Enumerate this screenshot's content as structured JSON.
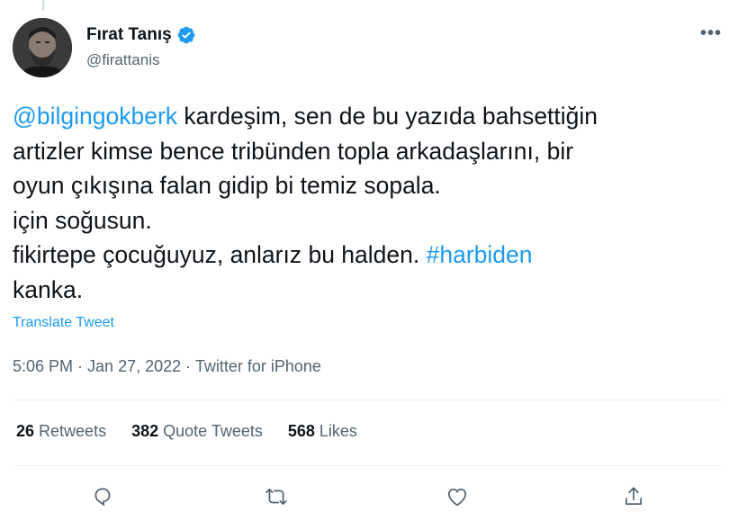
{
  "author": {
    "display_name": "Fırat Tanış",
    "handle": "@firattanis",
    "verified_icon": "verified-badge-icon",
    "avatar": "profile-photo"
  },
  "more_icon": "more-horizontal-icon",
  "tweet": {
    "line1_mention": "@bilgingokberk",
    "line1_rest": " kardeşim, sen de bu yazıda bahsettiğin",
    "line2": "artizler kimse bence tribünden topla arkadaşlarını, bir",
    "line3": "oyun çıkışına falan gidip bi temiz sopala.",
    "line4": "için soğusun.",
    "line5_text": "fikirtepe çocuğuyuz, anlarız bu halden. ",
    "line5_hashtag": "#harbiden",
    "line6": "kanka."
  },
  "translate_label": "Translate Tweet",
  "meta": {
    "time": "5:06 PM",
    "separator1": " · ",
    "date": "Jan 27, 2022",
    "separator2": " · ",
    "source": "Twitter for iPhone"
  },
  "stats": {
    "retweets_count": "26",
    "retweets_label": "Retweets",
    "quotes_count": "382",
    "quotes_label": "Quote Tweets",
    "likes_count": "568",
    "likes_label": "Likes"
  },
  "actions": {
    "reply_icon": "reply-icon",
    "retweet_icon": "retweet-icon",
    "like_icon": "like-icon",
    "share_icon": "share-icon"
  },
  "colors": {
    "link": "#1d9bf0",
    "text": "#0f1419",
    "secondary": "#536471",
    "divider": "#eff3f4"
  }
}
